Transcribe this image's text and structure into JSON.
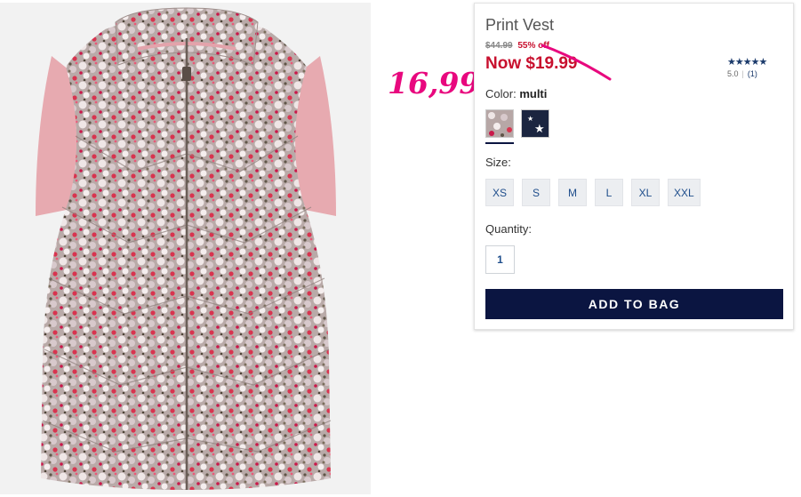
{
  "annotation": {
    "text": "16,99",
    "color": "#e8087e"
  },
  "product": {
    "title": "Print Vest",
    "old_price": "$44.99",
    "discount": "55% off",
    "now_price": "Now $19.99",
    "rating": {
      "stars": "★★★★★",
      "score": "5.0",
      "count": "(1)"
    },
    "color_label": "Color:",
    "color_value": "multi",
    "colors": [
      {
        "name": "multi",
        "selected": true
      },
      {
        "name": "navy star",
        "selected": false
      }
    ],
    "size_label": "Size:",
    "sizes": [
      "XS",
      "S",
      "M",
      "L",
      "XL",
      "XXL"
    ],
    "quantity_label": "Quantity:",
    "quantity_value": "1",
    "add_button": "ADD TO BAG"
  },
  "colors": {
    "sale_red": "#c8102e",
    "navy": "#0b1541",
    "link_blue": "#1f4e8c"
  }
}
